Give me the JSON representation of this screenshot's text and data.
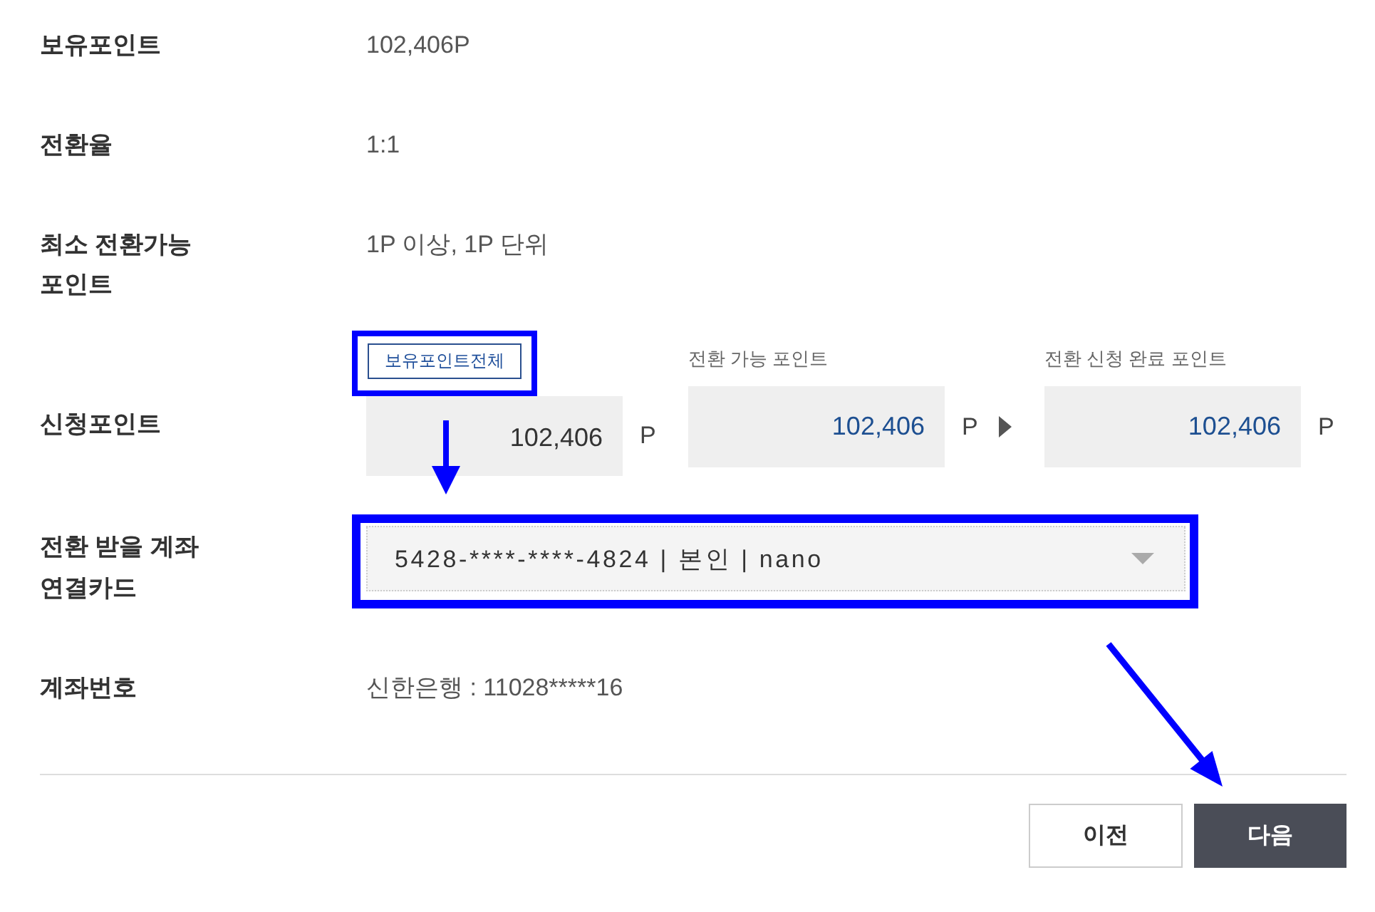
{
  "rows": [
    {
      "kind": "text",
      "label": "보유포인트",
      "value": "102,406P"
    },
    {
      "kind": "text",
      "label": "전환율",
      "value": "1:1"
    },
    {
      "kind": "text",
      "label": "최소 전환가능 포인트",
      "value": "1P 이상, 1P 단위"
    },
    {
      "kind": "points",
      "label": "신청포인트",
      "fields": [
        {
          "kind": "input",
          "button": {
            "label": "보유포인트전체",
            "highlighted": true
          },
          "value": "102,406",
          "unit": "P"
        },
        {
          "kind": "readonly",
          "caption": "전환 가능 포인트",
          "value": "102,406",
          "unit": "P",
          "arrow": true
        },
        {
          "kind": "readonly",
          "caption": "전환 신청 완료 포인트",
          "value": "102,406",
          "unit": "P"
        }
      ]
    },
    {
      "kind": "select",
      "label": "전환 받을 계좌 연결카드",
      "value": "5428-****-****-4824 | 본인 | nano",
      "highlighted": true
    },
    {
      "kind": "text",
      "label": "계좌번호",
      "value": "신한은행 : 11028*****16"
    }
  ],
  "buttons": [
    {
      "kind": "secondary",
      "label": "이전"
    },
    {
      "kind": "primary",
      "label": "다음"
    }
  ]
}
